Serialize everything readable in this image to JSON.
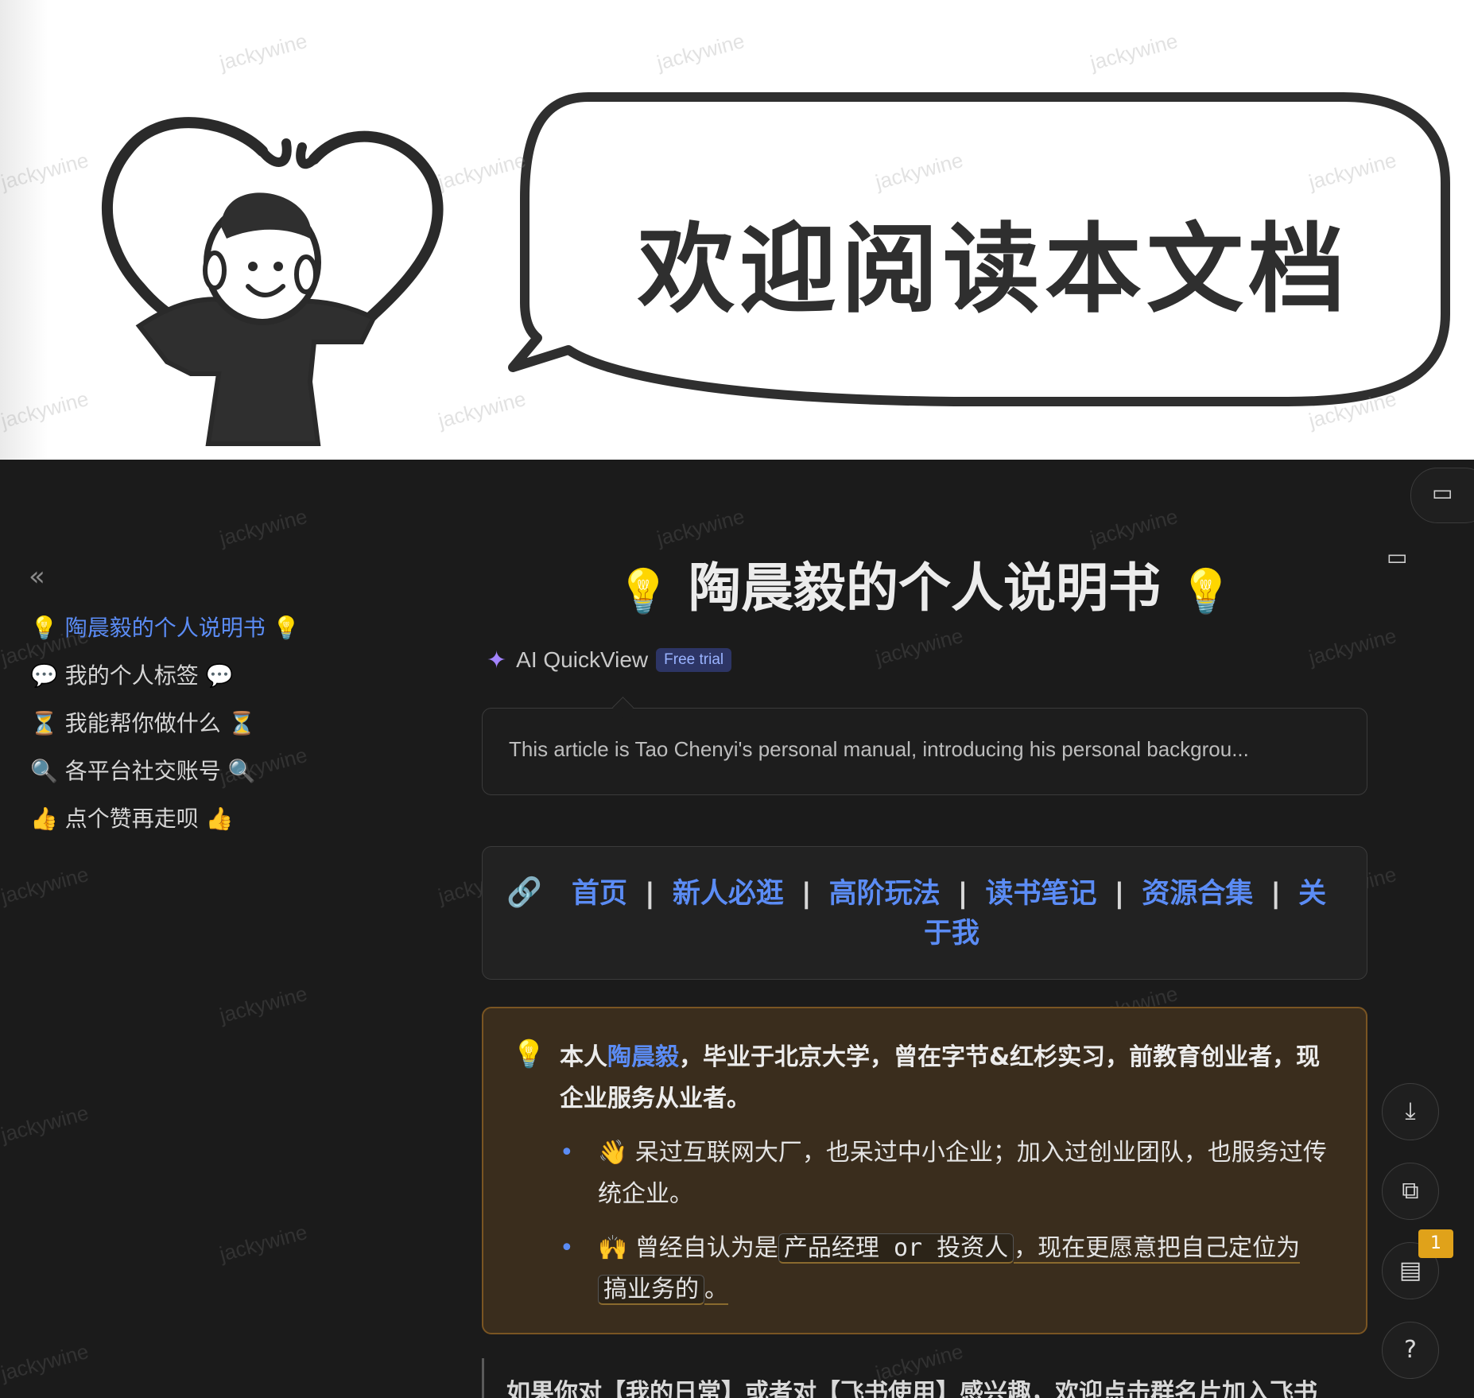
{
  "banner": {
    "bubble_text": "欢迎阅读本文档",
    "watermark": "jackywine"
  },
  "sidebar": {
    "items": [
      {
        "emoji_left": "💡",
        "label": "陶晨毅的个人说明书",
        "emoji_right": "💡"
      },
      {
        "emoji_left": "💬",
        "label": "我的个人标签",
        "emoji_right": "💬"
      },
      {
        "emoji_left": "⏳",
        "label": "我能帮你做什么",
        "emoji_right": "⏳"
      },
      {
        "emoji_left": "🔍",
        "label": "各平台社交账号",
        "emoji_right": "🔍"
      },
      {
        "emoji_left": "👍",
        "label": "点个赞再走呗",
        "emoji_right": "👍"
      }
    ]
  },
  "doc": {
    "title": "陶晨毅的个人说明书",
    "title_emoji": "💡",
    "ai_quickview": {
      "label": "AI QuickView",
      "badge": "Free trial"
    },
    "summary": "This article is Tao Chenyi's personal manual, introducing his personal backgrou...",
    "nav_links": [
      "首页",
      "新人必逛",
      "高阶玩法",
      "读书笔记",
      "资源合集"
    ],
    "nav_last_part1": "关",
    "nav_last_part2": "于我",
    "nav_sep": "|",
    "callout": {
      "icon": "💡",
      "head_prefix": "本人",
      "head_name": "陶晨毅",
      "head_rest": "，毕业于北京大学，曾在字节&红杉实习，前教育创业者，现企业服务从业者。",
      "bullet1": "👋 呆过互联网大厂，也呆过中小企业；加入过创业团队，也服务过传统企业。",
      "bullet2_pre": "🙌 曾经自认为是",
      "bullet2_code1": "产品经理 or 投资人",
      "bullet2_mid": "，现在更愿意把自己定位为",
      "bullet2_code2": "搞业务的",
      "bullet2_end": "。"
    },
    "quote": "如果你对【我的日常】或者对【飞书使用】感兴趣，欢迎点击群名片加入飞书"
  },
  "floating": {
    "badge_count": "1"
  },
  "colors": {
    "link": "#5b8cf5",
    "dark_bg": "#1b1b1b",
    "callout_bg": "#3a2d1d",
    "callout_border": "#7a5522",
    "badge": "#e0a21a"
  }
}
